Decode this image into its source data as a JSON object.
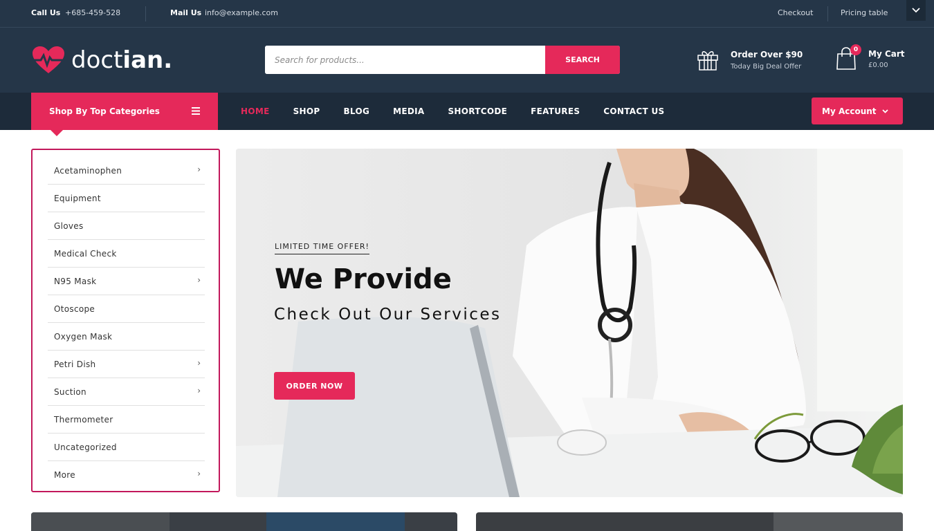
{
  "topbar": {
    "call_label": "Call Us",
    "call_value": "+685-459-528",
    "mail_label": "Mail Us",
    "mail_value": "info@example.com",
    "links": [
      "Checkout",
      "Pricing table"
    ]
  },
  "header": {
    "logo_light": "doct",
    "logo_bold": "ian.",
    "search_placeholder": "Search for products...",
    "search_button": "SEARCH",
    "offer_title": "Order Over $90",
    "offer_subtitle": "Today Big Deal Offer",
    "cart_count": "0",
    "cart_title": "My Cart",
    "cart_total": "£0.00"
  },
  "nav": {
    "categories_label": "Shop By Top Categories",
    "items": [
      "HOME",
      "SHOP",
      "BLOG",
      "MEDIA",
      "SHORTCODE",
      "FEATURES",
      "CONTACT US"
    ],
    "account_label": "My Account"
  },
  "sidebar": {
    "items": [
      {
        "label": "Acetaminophen",
        "has_sub": true
      },
      {
        "label": "Equipment",
        "has_sub": false
      },
      {
        "label": "Gloves",
        "has_sub": false
      },
      {
        "label": "Medical Check",
        "has_sub": false
      },
      {
        "label": "N95 Mask",
        "has_sub": true
      },
      {
        "label": "Otoscope",
        "has_sub": false
      },
      {
        "label": "Oxygen Mask",
        "has_sub": false
      },
      {
        "label": "Petri Dish",
        "has_sub": true
      },
      {
        "label": "Suction",
        "has_sub": true
      },
      {
        "label": "Thermometer",
        "has_sub": false
      },
      {
        "label": "Uncategorized",
        "has_sub": false
      },
      {
        "label": "More",
        "has_sub": true
      }
    ]
  },
  "hero": {
    "tag": "LIMITED TIME OFFER!",
    "headline": "We Provide",
    "subheadline": "Check Out Our Services",
    "cta": "ORDER NOW"
  },
  "colors": {
    "navy": "#253648",
    "navy_dark": "#1d2b3a",
    "accent": "#e5295a",
    "sidebar_border": "#c2185b"
  },
  "icons": [
    "heart-pulse-logo-icon",
    "chevron-down-icon",
    "gift-icon",
    "shopping-bag-icon",
    "hamburger-menu-icon",
    "chevron-right-icon",
    "stethoscope-icon"
  ]
}
